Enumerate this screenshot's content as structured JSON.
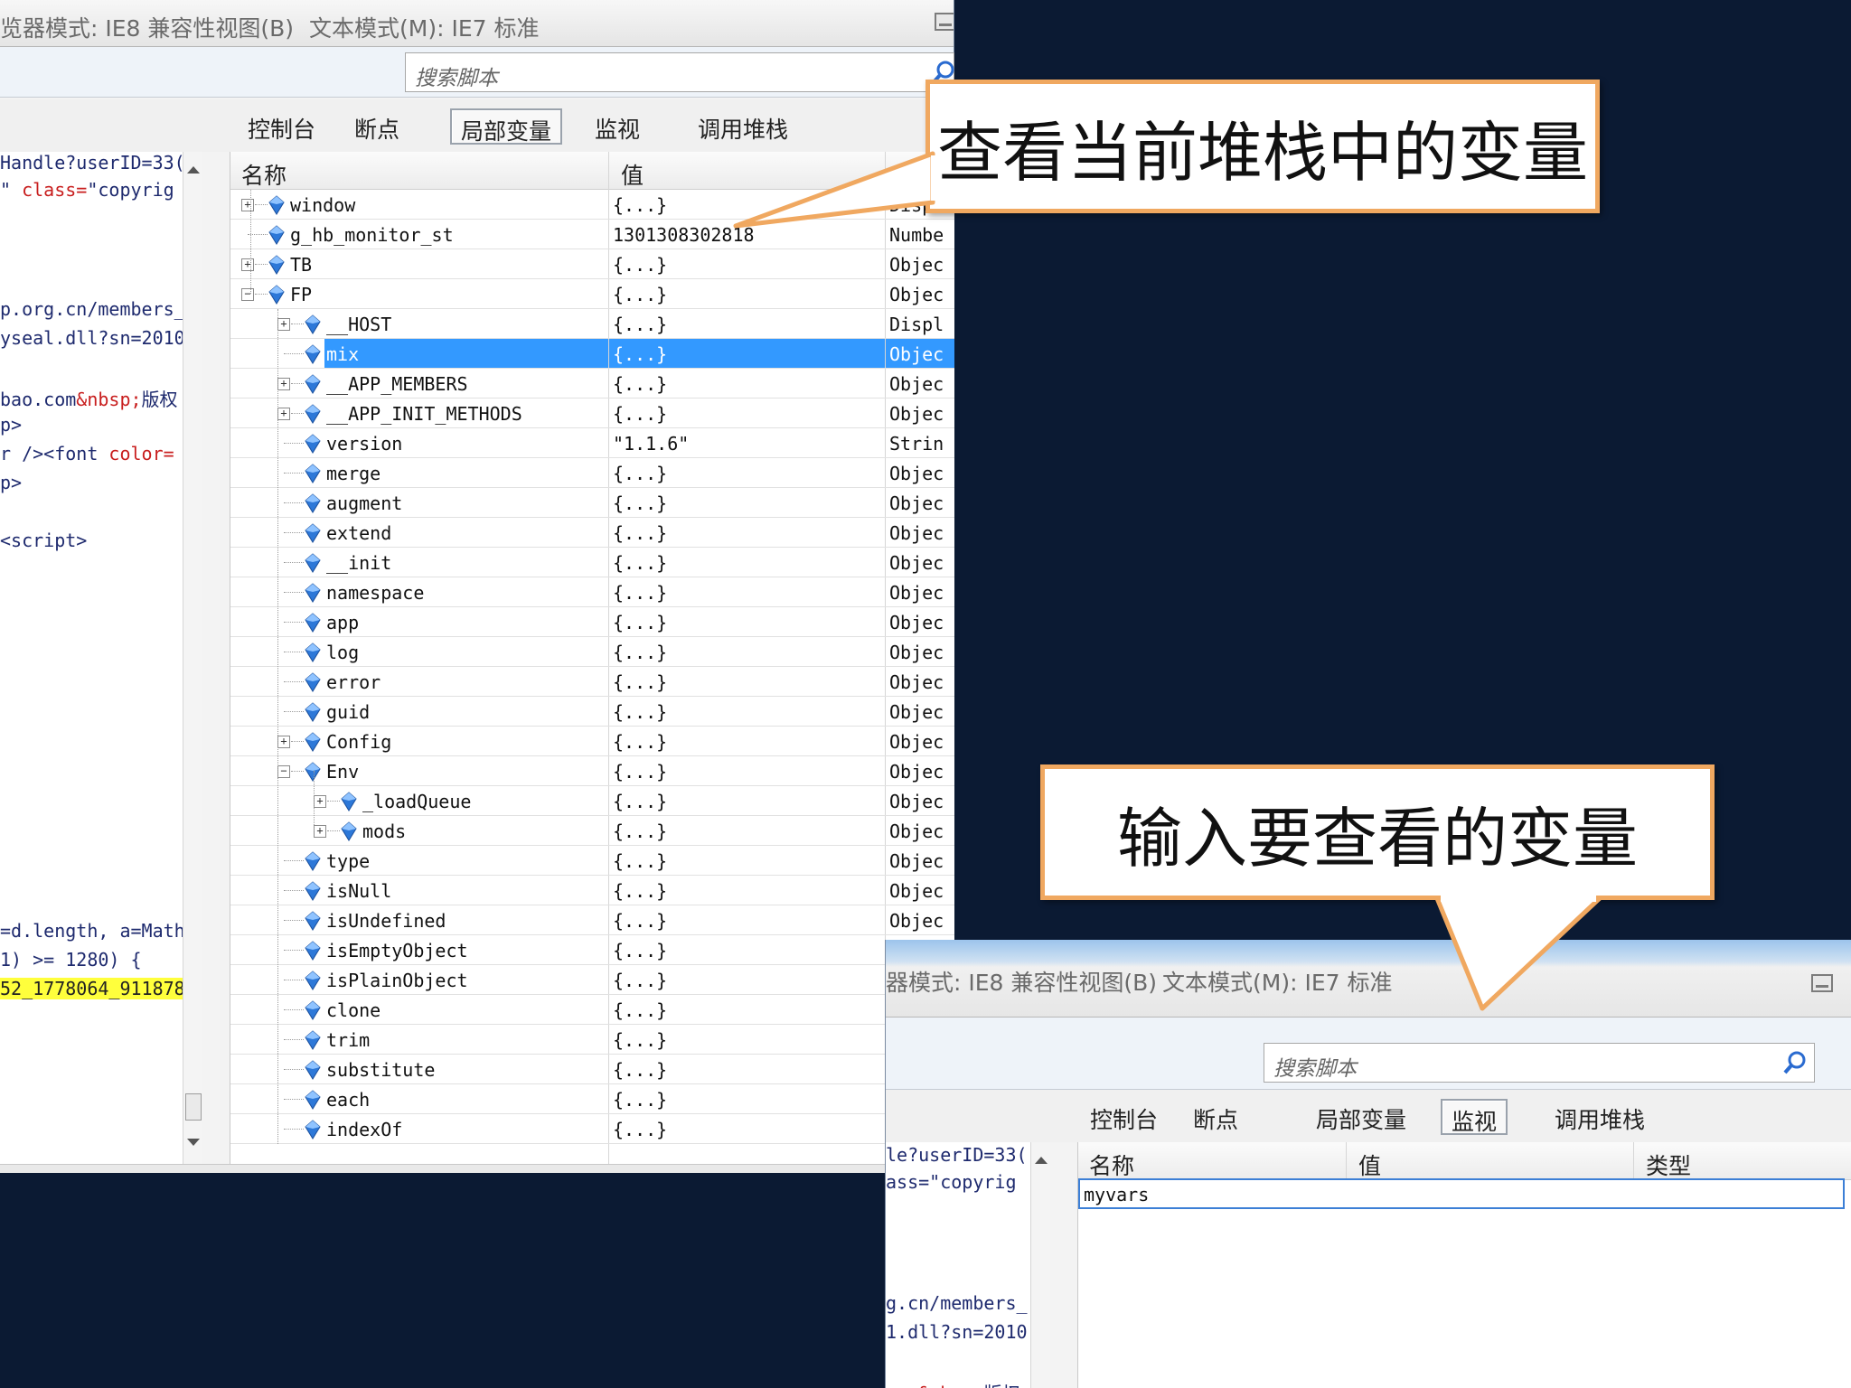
{
  "window1": {
    "title_browser_mode": "览器模式: IE8 兼容性视图(B)",
    "title_doc_mode": "文本模式(M): IE7 标准",
    "search_placeholder": "搜索脚本",
    "tabs": [
      "控制台",
      "断点",
      "局部变量",
      "监视",
      "调用堆栈"
    ],
    "active_tab": "局部变量",
    "code_lines": [
      {
        "text": "Handle?userID=33(",
        "hl": false
      },
      {
        "text": "\" class=\"copyrig",
        "hl": false
      },
      {
        "text": "p.org.cn/members_",
        "hl": false
      },
      {
        "text": "yseal.dll?sn=2010",
        "hl": false
      },
      {
        "text": "bao.com&nbsp;版权",
        "hl": false
      },
      {
        "text": "p>",
        "hl": false
      },
      {
        "text": "r /><font color=",
        "hl": false
      },
      {
        "text": "p>",
        "hl": false
      },
      {
        "text": "<script>",
        "hl": false
      },
      {
        "text": "=d.length, a=Math.",
        "hl": false
      },
      {
        "text": "1) >= 1280) {",
        "hl": false
      },
      {
        "text": "52_1778064_911878",
        "hl": true
      }
    ],
    "grid_headers": {
      "name": "名称",
      "value": "值"
    },
    "rows": [
      {
        "name": "window",
        "value": "{...}",
        "type": "Disp",
        "depth": 0,
        "expander": "plus"
      },
      {
        "name": "g_hb_monitor_st",
        "value": "1301308302818",
        "type": "Numbe",
        "depth": 0,
        "expander": "none"
      },
      {
        "name": "TB",
        "value": "{...}",
        "type": "Objec",
        "depth": 0,
        "expander": "plus"
      },
      {
        "name": "FP",
        "value": "{...}",
        "type": "Objec",
        "depth": 0,
        "expander": "minus"
      },
      {
        "name": "__HOST",
        "value": "{...}",
        "type": "Displ",
        "depth": 1,
        "expander": "plus"
      },
      {
        "name": "mix",
        "value": "{...}",
        "type": "Objec",
        "depth": 1,
        "expander": "none",
        "selected": true
      },
      {
        "name": "__APP_MEMBERS",
        "value": "{...}",
        "type": "Objec",
        "depth": 1,
        "expander": "plus"
      },
      {
        "name": "__APP_INIT_METHODS",
        "value": "{...}",
        "type": "Objec",
        "depth": 1,
        "expander": "plus"
      },
      {
        "name": "version",
        "value": "\"1.1.6\"",
        "type": "Strin",
        "depth": 1,
        "expander": "none"
      },
      {
        "name": "merge",
        "value": "{...}",
        "type": "Objec",
        "depth": 1,
        "expander": "none"
      },
      {
        "name": "augment",
        "value": "{...}",
        "type": "Objec",
        "depth": 1,
        "expander": "none"
      },
      {
        "name": "extend",
        "value": "{...}",
        "type": "Objec",
        "depth": 1,
        "expander": "none"
      },
      {
        "name": "__init",
        "value": "{...}",
        "type": "Objec",
        "depth": 1,
        "expander": "none"
      },
      {
        "name": "namespace",
        "value": "{...}",
        "type": "Objec",
        "depth": 1,
        "expander": "none"
      },
      {
        "name": "app",
        "value": "{...}",
        "type": "Objec",
        "depth": 1,
        "expander": "none"
      },
      {
        "name": "log",
        "value": "{...}",
        "type": "Objec",
        "depth": 1,
        "expander": "none"
      },
      {
        "name": "error",
        "value": "{...}",
        "type": "Objec",
        "depth": 1,
        "expander": "none"
      },
      {
        "name": "guid",
        "value": "{...}",
        "type": "Objec",
        "depth": 1,
        "expander": "none"
      },
      {
        "name": "Config",
        "value": "{...}",
        "type": "Objec",
        "depth": 1,
        "expander": "plus"
      },
      {
        "name": "Env",
        "value": "{...}",
        "type": "Objec",
        "depth": 1,
        "expander": "minus"
      },
      {
        "name": "_loadQueue",
        "value": "{...}",
        "type": "Objec",
        "depth": 2,
        "expander": "plus"
      },
      {
        "name": "mods",
        "value": "{...}",
        "type": "Objec",
        "depth": 2,
        "expander": "plus"
      },
      {
        "name": "type",
        "value": "{...}",
        "type": "Objec",
        "depth": 1,
        "expander": "none"
      },
      {
        "name": "isNull",
        "value": "{...}",
        "type": "Objec",
        "depth": 1,
        "expander": "none"
      },
      {
        "name": "isUndefined",
        "value": "{...}",
        "type": "Objec",
        "depth": 1,
        "expander": "none"
      },
      {
        "name": "isEmptyObject",
        "value": "{...}",
        "type": "",
        "depth": 1,
        "expander": "none"
      },
      {
        "name": "isPlainObject",
        "value": "{...}",
        "type": "",
        "depth": 1,
        "expander": "none"
      },
      {
        "name": "clone",
        "value": "{...}",
        "type": "",
        "depth": 1,
        "expander": "none"
      },
      {
        "name": "trim",
        "value": "{...}",
        "type": "",
        "depth": 1,
        "expander": "none"
      },
      {
        "name": "substitute",
        "value": "{...}",
        "type": "",
        "depth": 1,
        "expander": "none"
      },
      {
        "name": "each",
        "value": "{...}",
        "type": "",
        "depth": 1,
        "expander": "none"
      },
      {
        "name": "indexOf",
        "value": "{...}",
        "type": "",
        "depth": 1,
        "expander": "none"
      }
    ]
  },
  "window2": {
    "title_browser_mode": "器模式: IE8 兼容性视图(B)",
    "title_doc_mode": "文本模式(M): IE7 标准",
    "search_placeholder": "搜索脚本",
    "tabs": [
      "控制台",
      "断点",
      "局部变量",
      "监视",
      "调用堆栈"
    ],
    "active_tab": "监视",
    "code_lines": [
      {
        "text": "le?userID=33("
      },
      {
        "text": "ass=\"copyrig"
      },
      {
        "text": "g.cn/members_"
      },
      {
        "text": "1.dll?sn=2010"
      },
      {
        "text": "com&nbsp;版权"
      }
    ],
    "grid_headers": {
      "name": "名称",
      "value": "值",
      "type": "类型"
    },
    "watch_input": "myvars"
  },
  "callouts": {
    "top": "查看当前堆栈中的变量",
    "bottom": "输入要查看的变量"
  },
  "colors": {
    "background": "#0b1a33",
    "callout_border": "#f0a860",
    "selection": "#3399ff",
    "highlight": "#ffff3c"
  }
}
